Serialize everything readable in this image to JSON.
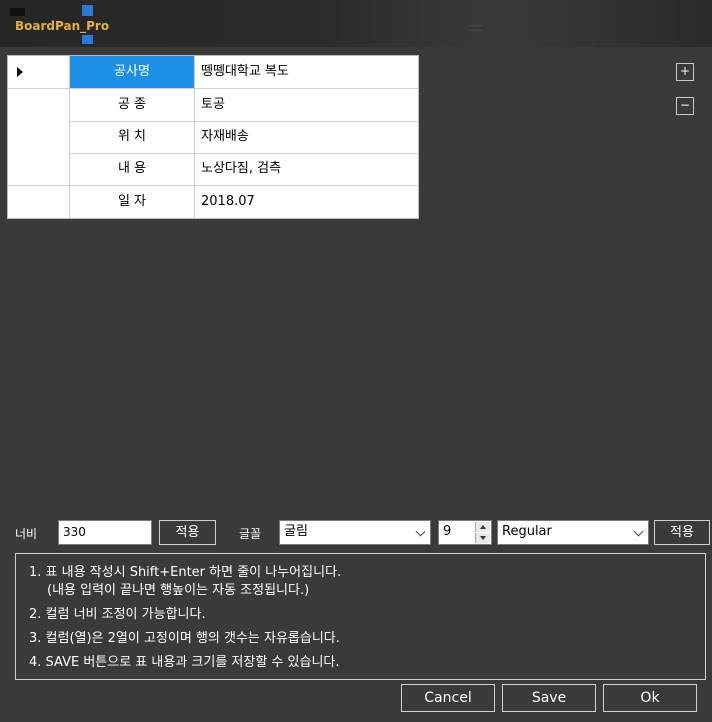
{
  "app": {
    "title": "BoardPan_Pro"
  },
  "grid": {
    "rows": [
      {
        "key": "공사명",
        "value": "뗑뗑대학교 복도",
        "selected": true
      },
      {
        "key": "공 종",
        "value": "토공",
        "selected": false
      },
      {
        "key": "위 치",
        "value": "자재배송",
        "selected": false
      },
      {
        "key": "내 용",
        "value": "노상다짐, 검측",
        "selected": false
      },
      {
        "key": "일 자",
        "value": "2018.07",
        "selected": false
      }
    ]
  },
  "row_buttons": {
    "add": "+",
    "remove": "−"
  },
  "width_control": {
    "label": "너비",
    "value": "330",
    "apply_label": "적용"
  },
  "font_control": {
    "label": "글꼴",
    "family": "굴림",
    "size": "9",
    "style": "Regular",
    "apply_label": "적용"
  },
  "notes": [
    "1. 표 내용 작성시 Shift+Enter 하면 줄이 나누어집니다.",
    "(내용 입력이 끝나면 행높이는 자동 조정됩니다.)",
    "2. 컬럼 너비 조정이 가능합니다.",
    "3. 컬럼(열)은 2열이 고정이며 행의 갯수는 자유롭습니다.",
    "4. SAVE 버튼으로 표 내용과 크기를 저장할 수 있습니다."
  ],
  "footer": {
    "cancel": "Cancel",
    "save": "Save",
    "ok": "Ok"
  },
  "colors": {
    "selected_cell": "#1e8fe6",
    "background": "#3a3a3a",
    "title_accent": "#e2b23a"
  }
}
